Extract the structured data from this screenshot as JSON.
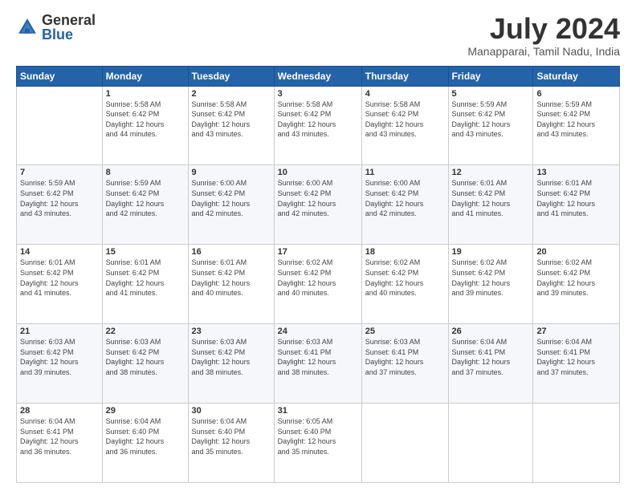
{
  "header": {
    "logo_general": "General",
    "logo_blue": "Blue",
    "month_title": "July 2024",
    "location": "Manapparai, Tamil Nadu, India"
  },
  "columns": [
    "Sunday",
    "Monday",
    "Tuesday",
    "Wednesday",
    "Thursday",
    "Friday",
    "Saturday"
  ],
  "weeks": [
    [
      {
        "day": "",
        "info": ""
      },
      {
        "day": "1",
        "info": "Sunrise: 5:58 AM\nSunset: 6:42 PM\nDaylight: 12 hours\nand 44 minutes."
      },
      {
        "day": "2",
        "info": "Sunrise: 5:58 AM\nSunset: 6:42 PM\nDaylight: 12 hours\nand 43 minutes."
      },
      {
        "day": "3",
        "info": "Sunrise: 5:58 AM\nSunset: 6:42 PM\nDaylight: 12 hours\nand 43 minutes."
      },
      {
        "day": "4",
        "info": "Sunrise: 5:58 AM\nSunset: 6:42 PM\nDaylight: 12 hours\nand 43 minutes."
      },
      {
        "day": "5",
        "info": "Sunrise: 5:59 AM\nSunset: 6:42 PM\nDaylight: 12 hours\nand 43 minutes."
      },
      {
        "day": "6",
        "info": "Sunrise: 5:59 AM\nSunset: 6:42 PM\nDaylight: 12 hours\nand 43 minutes."
      }
    ],
    [
      {
        "day": "7",
        "info": "Sunrise: 5:59 AM\nSunset: 6:42 PM\nDaylight: 12 hours\nand 43 minutes."
      },
      {
        "day": "8",
        "info": "Sunrise: 5:59 AM\nSunset: 6:42 PM\nDaylight: 12 hours\nand 42 minutes."
      },
      {
        "day": "9",
        "info": "Sunrise: 6:00 AM\nSunset: 6:42 PM\nDaylight: 12 hours\nand 42 minutes."
      },
      {
        "day": "10",
        "info": "Sunrise: 6:00 AM\nSunset: 6:42 PM\nDaylight: 12 hours\nand 42 minutes."
      },
      {
        "day": "11",
        "info": "Sunrise: 6:00 AM\nSunset: 6:42 PM\nDaylight: 12 hours\nand 42 minutes."
      },
      {
        "day": "12",
        "info": "Sunrise: 6:01 AM\nSunset: 6:42 PM\nDaylight: 12 hours\nand 41 minutes."
      },
      {
        "day": "13",
        "info": "Sunrise: 6:01 AM\nSunset: 6:42 PM\nDaylight: 12 hours\nand 41 minutes."
      }
    ],
    [
      {
        "day": "14",
        "info": "Sunrise: 6:01 AM\nSunset: 6:42 PM\nDaylight: 12 hours\nand 41 minutes."
      },
      {
        "day": "15",
        "info": "Sunrise: 6:01 AM\nSunset: 6:42 PM\nDaylight: 12 hours\nand 41 minutes."
      },
      {
        "day": "16",
        "info": "Sunrise: 6:01 AM\nSunset: 6:42 PM\nDaylight: 12 hours\nand 40 minutes."
      },
      {
        "day": "17",
        "info": "Sunrise: 6:02 AM\nSunset: 6:42 PM\nDaylight: 12 hours\nand 40 minutes."
      },
      {
        "day": "18",
        "info": "Sunrise: 6:02 AM\nSunset: 6:42 PM\nDaylight: 12 hours\nand 40 minutes."
      },
      {
        "day": "19",
        "info": "Sunrise: 6:02 AM\nSunset: 6:42 PM\nDaylight: 12 hours\nand 39 minutes."
      },
      {
        "day": "20",
        "info": "Sunrise: 6:02 AM\nSunset: 6:42 PM\nDaylight: 12 hours\nand 39 minutes."
      }
    ],
    [
      {
        "day": "21",
        "info": "Sunrise: 6:03 AM\nSunset: 6:42 PM\nDaylight: 12 hours\nand 39 minutes."
      },
      {
        "day": "22",
        "info": "Sunrise: 6:03 AM\nSunset: 6:42 PM\nDaylight: 12 hours\nand 38 minutes."
      },
      {
        "day": "23",
        "info": "Sunrise: 6:03 AM\nSunset: 6:42 PM\nDaylight: 12 hours\nand 38 minutes."
      },
      {
        "day": "24",
        "info": "Sunrise: 6:03 AM\nSunset: 6:41 PM\nDaylight: 12 hours\nand 38 minutes."
      },
      {
        "day": "25",
        "info": "Sunrise: 6:03 AM\nSunset: 6:41 PM\nDaylight: 12 hours\nand 37 minutes."
      },
      {
        "day": "26",
        "info": "Sunrise: 6:04 AM\nSunset: 6:41 PM\nDaylight: 12 hours\nand 37 minutes."
      },
      {
        "day": "27",
        "info": "Sunrise: 6:04 AM\nSunset: 6:41 PM\nDaylight: 12 hours\nand 37 minutes."
      }
    ],
    [
      {
        "day": "28",
        "info": "Sunrise: 6:04 AM\nSunset: 6:41 PM\nDaylight: 12 hours\nand 36 minutes."
      },
      {
        "day": "29",
        "info": "Sunrise: 6:04 AM\nSunset: 6:40 PM\nDaylight: 12 hours\nand 36 minutes."
      },
      {
        "day": "30",
        "info": "Sunrise: 6:04 AM\nSunset: 6:40 PM\nDaylight: 12 hours\nand 35 minutes."
      },
      {
        "day": "31",
        "info": "Sunrise: 6:05 AM\nSunset: 6:40 PM\nDaylight: 12 hours\nand 35 minutes."
      },
      {
        "day": "",
        "info": ""
      },
      {
        "day": "",
        "info": ""
      },
      {
        "day": "",
        "info": ""
      }
    ]
  ]
}
